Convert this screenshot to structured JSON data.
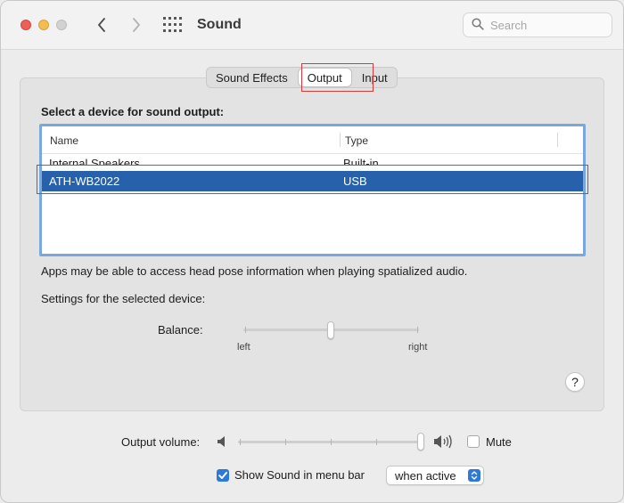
{
  "window": {
    "title": "Sound"
  },
  "search": {
    "placeholder": "Search"
  },
  "tabs": [
    {
      "label": "Sound Effects",
      "selected": false
    },
    {
      "label": "Output",
      "selected": true
    },
    {
      "label": "Input",
      "selected": false
    }
  ],
  "output": {
    "heading": "Select a device for sound output:",
    "columns": [
      "Name",
      "Type"
    ],
    "devices": [
      {
        "name": "Internal Speakers",
        "type": "Built-in"
      },
      {
        "name": "ATH-WB2022",
        "type": "USB",
        "selected": true
      }
    ],
    "info": "Apps may be able to access head pose information when playing spatialized audio.",
    "settings_label": "Settings for the selected device:",
    "balance": {
      "label": "Balance:",
      "left_label": "left",
      "right_label": "right",
      "value": 0.5
    }
  },
  "volume": {
    "label": "Output volume:",
    "value": 1.0,
    "mute_label": "Mute",
    "muted": false
  },
  "menubar": {
    "label": "Show Sound in menu bar",
    "checked": true,
    "option": "when active"
  },
  "colors": {
    "selection": "#2761ac",
    "accent": "#2d78d8",
    "highlight": "#d33b3b"
  }
}
